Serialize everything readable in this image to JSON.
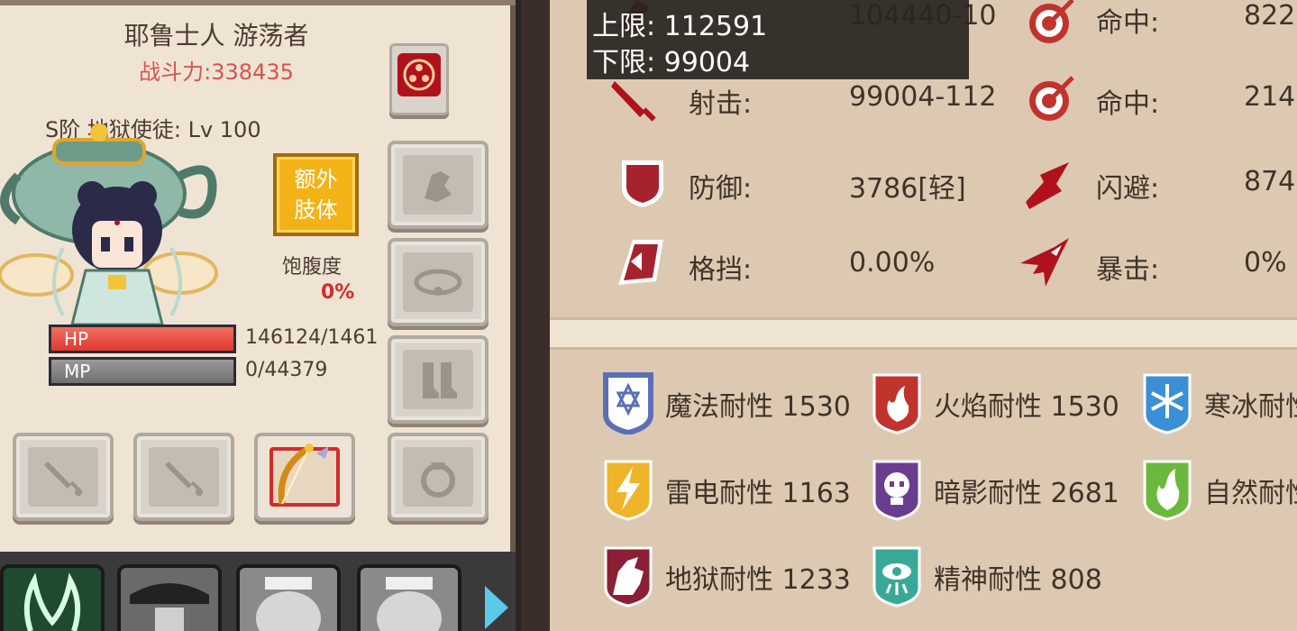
{
  "character": {
    "title": "耶鲁士人 游荡者",
    "power_label": "战斗力:",
    "power_value": "338435",
    "class_line": "S阶 地狱使徒: Lv 100"
  },
  "extra_limb": {
    "label_line1": "额外",
    "label_line2": "肢体"
  },
  "hunger": {
    "label": "饱腹度",
    "value": "0%"
  },
  "bars": {
    "hp": {
      "label": "HP",
      "value": "146124/1461",
      "fill": 1.0
    },
    "mp": {
      "label": "MP",
      "value": "0/44379",
      "fill": 0.0
    }
  },
  "tooltip": {
    "upper": "上限: 112591",
    "lower": "下限: 99004"
  },
  "stats": [
    {
      "label": "",
      "value": "104440-10",
      "icon": "hand-icon"
    },
    {
      "label": "射击:",
      "value": "99004-112",
      "icon": "sword-icon"
    },
    {
      "label": "防御:",
      "value": "3786[轻]",
      "icon": "shield-icon"
    },
    {
      "label": "格挡:",
      "value": "0.00%",
      "icon": "block-icon"
    }
  ],
  "stats_right": [
    {
      "label": "命中:",
      "value": "822",
      "icon": "target-icon"
    },
    {
      "label": "命中:",
      "value": "214",
      "icon": "target-icon"
    },
    {
      "label": "闪避:",
      "value": "874",
      "icon": "dodge-icon"
    },
    {
      "label": "暴击:",
      "value": "0%",
      "icon": "crit-icon"
    }
  ],
  "resistances": [
    {
      "text": "魔法耐性 1530",
      "icon": "magic-resist-icon",
      "color": "#5a6fb5"
    },
    {
      "text": "火焰耐性 1530",
      "icon": "fire-resist-icon",
      "color": "#c0342c"
    },
    {
      "text": "寒冰耐性",
      "icon": "ice-resist-icon",
      "color": "#3b8fd6"
    },
    {
      "text": "雷电耐性 1163",
      "icon": "lightning-resist-icon",
      "color": "#f0b428"
    },
    {
      "text": "暗影耐性 2681",
      "icon": "shadow-resist-icon",
      "color": "#6a3d8e"
    },
    {
      "text": "自然耐性",
      "icon": "nature-resist-icon",
      "color": "#6cb83c"
    },
    {
      "text": "地狱耐性 1233",
      "icon": "hell-resist-icon",
      "color": "#8a1f36"
    },
    {
      "text": "精神耐性 808",
      "icon": "spirit-resist-icon",
      "color": "#3aa897"
    }
  ],
  "colors": {
    "hp": "#e0392f",
    "mp": "#6f6f6f",
    "accent": "#f3b317",
    "power": "#d9534f"
  }
}
